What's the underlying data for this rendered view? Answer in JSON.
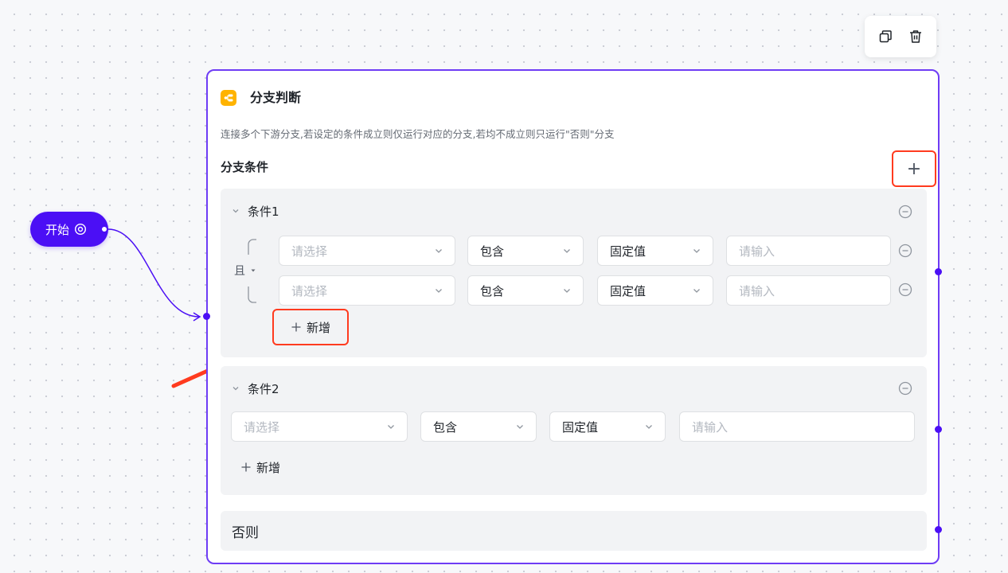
{
  "toolbar": {
    "copy_icon": "copy-icon",
    "delete_icon": "trash-icon"
  },
  "start_node": {
    "label": "开始",
    "icon": "settings-icon"
  },
  "node": {
    "title": "分支判断",
    "icon": "branch-icon",
    "description": "连接多个下游分支,若设定的条件成立则仅运行对应的分支,若均不成立则只运行\"否则\"分支",
    "section_title": "分支条件",
    "add_branch_label": "+",
    "else_label": "否则"
  },
  "conditions": [
    {
      "title": "条件1",
      "logic": "且",
      "rows": [
        {
          "variable_placeholder": "请选择",
          "operator": "包含",
          "value_type": "固定值",
          "value_placeholder": "请输入"
        },
        {
          "variable_placeholder": "请选择",
          "operator": "包含",
          "value_type": "固定值",
          "value_placeholder": "请输入"
        }
      ],
      "add_label": "新增"
    },
    {
      "title": "条件2",
      "rows": [
        {
          "variable_placeholder": "请选择",
          "operator": "包含",
          "value_type": "固定值",
          "value_placeholder": "请输入"
        }
      ],
      "add_label": "新增"
    }
  ],
  "colors": {
    "primary": "#4b0ff5",
    "accent_border": "#6e3cf5",
    "highlight": "#ff3b1f",
    "node_icon": "#ffb300"
  }
}
